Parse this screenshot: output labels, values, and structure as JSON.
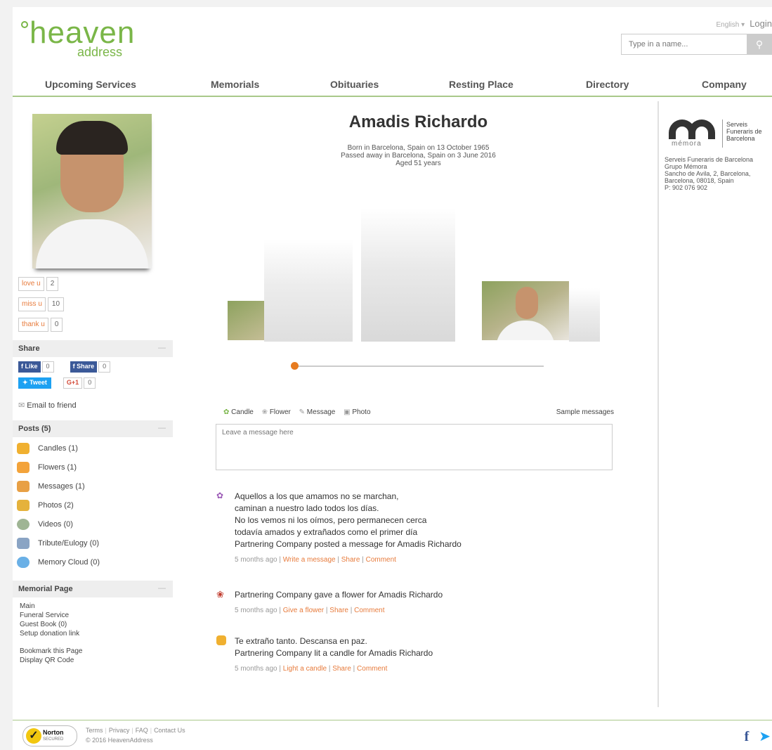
{
  "header": {
    "logo_word": "heaven",
    "logo_sub": "address",
    "language": "English ▾",
    "login": "Login",
    "search_placeholder": "Type in a name..."
  },
  "nav": [
    "Upcoming Services",
    "Memorials",
    "Obituaries",
    "Resting Place",
    "Directory",
    "Company"
  ],
  "reactions": [
    {
      "label": "love u",
      "count": "2"
    },
    {
      "label": "miss u",
      "count": "10"
    },
    {
      "label": "thank u",
      "count": "0"
    }
  ],
  "share": {
    "heading": "Share",
    "like_label": "Like",
    "like_count": "0",
    "share_label": "Share",
    "share_count": "0",
    "tweet_label": "Tweet",
    "gplus_label": "G+1",
    "gplus_count": "0",
    "email_friend": "Email to friend"
  },
  "posts": {
    "heading": "Posts (5)",
    "items": [
      {
        "label": "Candles (1)",
        "icon": "candle-icon",
        "color": "#f0b030"
      },
      {
        "label": "Flowers (1)",
        "icon": "flower-icon",
        "color": "#f3a33a"
      },
      {
        "label": "Messages (1)",
        "icon": "message-icon",
        "color": "#e8a045"
      },
      {
        "label": "Photos (2)",
        "icon": "photo-icon",
        "color": "#e5b23c"
      },
      {
        "label": "Videos (0)",
        "icon": "video-icon",
        "color": "#9fb594"
      },
      {
        "label": "Tribute/Eulogy (0)",
        "icon": "tribute-icon",
        "color": "#8aa4c4"
      },
      {
        "label": "Memory Cloud (0)",
        "icon": "cloud-icon",
        "color": "#6ab0e6"
      }
    ]
  },
  "memorial_page": {
    "heading": "Memorial Page",
    "links": [
      "Main",
      "Funeral Service",
      "Guest Book (0)",
      "Setup donation link"
    ],
    "links2": [
      "Bookmark this Page",
      "Display QR Code"
    ]
  },
  "person": {
    "name": "Amadis Richardo",
    "born": "Born in Barcelona, Spain on 13 October 1965",
    "passed": "Passed away in Barcelona, Spain on 3 June 2016",
    "aged": "Aged 51 years"
  },
  "message_tabs": {
    "candle": "Candle",
    "flower": "Flower",
    "message": "Message",
    "photo": "Photo",
    "sample": "Sample messages",
    "placeholder": "Leave a message here"
  },
  "feed": [
    {
      "icon": "message-icon",
      "lines": [
        "Aquellos a los que amamos no se marchan,",
        "caminan a nuestro lado todos los días.",
        "No los vemos ni los oímos, pero permanecen cerca",
        "todavía amados y extrañados como el primer día",
        "Partnering Company posted a message for Amadis Richardo"
      ],
      "time": "5 months ago",
      "action": "Write a message",
      "share": "Share",
      "comment": "Comment"
    },
    {
      "icon": "flower-icon",
      "lines": [
        "Partnering Company gave a flower for Amadis Richardo"
      ],
      "time": "5 months ago",
      "action": "Give a flower",
      "share": "Share",
      "comment": "Comment"
    },
    {
      "icon": "candle-icon",
      "lines": [
        "Te extraño tanto. Descansa en paz.",
        "Partnering Company lit a candle for Amadis Richardo"
      ],
      "time": "5 months ago",
      "action": "Light a candle",
      "share": "Share",
      "comment": "Comment"
    }
  ],
  "funeral_home": {
    "logo_word": "mémora",
    "logo_name": [
      "Serveis",
      "Funeraris de",
      "Barcelona"
    ],
    "info": [
      "Serveis Funeraris de Barcelona",
      "Grupo Mémora",
      "Sancho de Avila, 2, Barcelona,",
      "Barcelona, 08018, Spain",
      "P: 902 076 902"
    ]
  },
  "footer": {
    "norton": "Norton",
    "norton_sub": "SECURED",
    "links": [
      "Terms",
      "Privacy",
      "FAQ",
      "Contact Us"
    ],
    "copyright": "© 2016 HeavenAddress"
  },
  "colors": {
    "brand_green": "#7ab648",
    "accent_orange": "#e77b3c",
    "facebook": "#3b5998",
    "twitter": "#1da1f2"
  }
}
